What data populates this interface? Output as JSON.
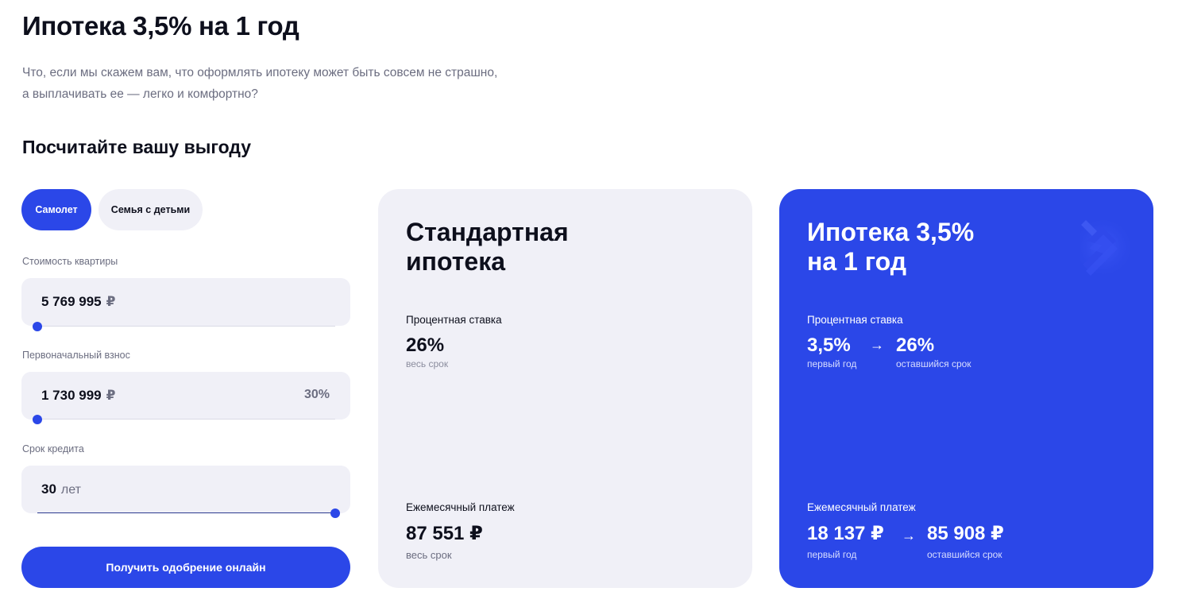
{
  "page": {
    "title": "Ипотека 3,5% на 1 год",
    "intro": "Что, если мы скажем вам, что оформлять ипотеку может быть совсем не страшно, а выплачивать ее — легко и комфортно?",
    "subtitle": "Посчитайте вашу выгоду"
  },
  "calculator": {
    "tabs": [
      {
        "label": "Самолет",
        "active": true
      },
      {
        "label": "Семья с детьми",
        "active": false
      }
    ],
    "price": {
      "label": "Стоимость квартиры",
      "value": "5 769 995",
      "unit": "₽",
      "slider_fraction": 0.0
    },
    "down_payment": {
      "label": "Первоначальный взнос",
      "value": "1 730 999",
      "unit": "₽",
      "percent": "30%",
      "slider_fraction": 0.0
    },
    "term": {
      "label": "Срок кредита",
      "value": "30",
      "unit": "лет",
      "slider_fraction": 1.0
    },
    "cta_label": "Получить одобрение онлайн"
  },
  "standard_card": {
    "title_line1": "Стандартная",
    "title_line2": "ипотека",
    "rate_label": "Процентная ставка",
    "rate_value": "26%",
    "rate_note": "весь срок",
    "payment_label": "Ежемесячный платеж",
    "payment_value": "87 551 ₽",
    "payment_note": "весь срок"
  },
  "promo_card": {
    "title_line1": "Ипотека 3,5%",
    "title_line2": "на 1 год",
    "rate_label": "Процентная ставка",
    "rate_first": "3,5%",
    "rate_first_note": "первый год",
    "rate_rest": "26%",
    "rate_rest_note": "оставшийся срок",
    "payment_label": "Ежемесячный платеж",
    "payment_first": "18 137 ₽",
    "payment_first_note": "первый год",
    "payment_rest": "85 908 ₽",
    "payment_rest_note": "оставшийся срок",
    "arrow_icon": "arrow-right-icon",
    "logo_icon": "chevron-logo-icon"
  },
  "colors": {
    "accent": "#2b47e8",
    "card_bg": "#f0f0f7",
    "muted_text": "#6b6d80"
  }
}
